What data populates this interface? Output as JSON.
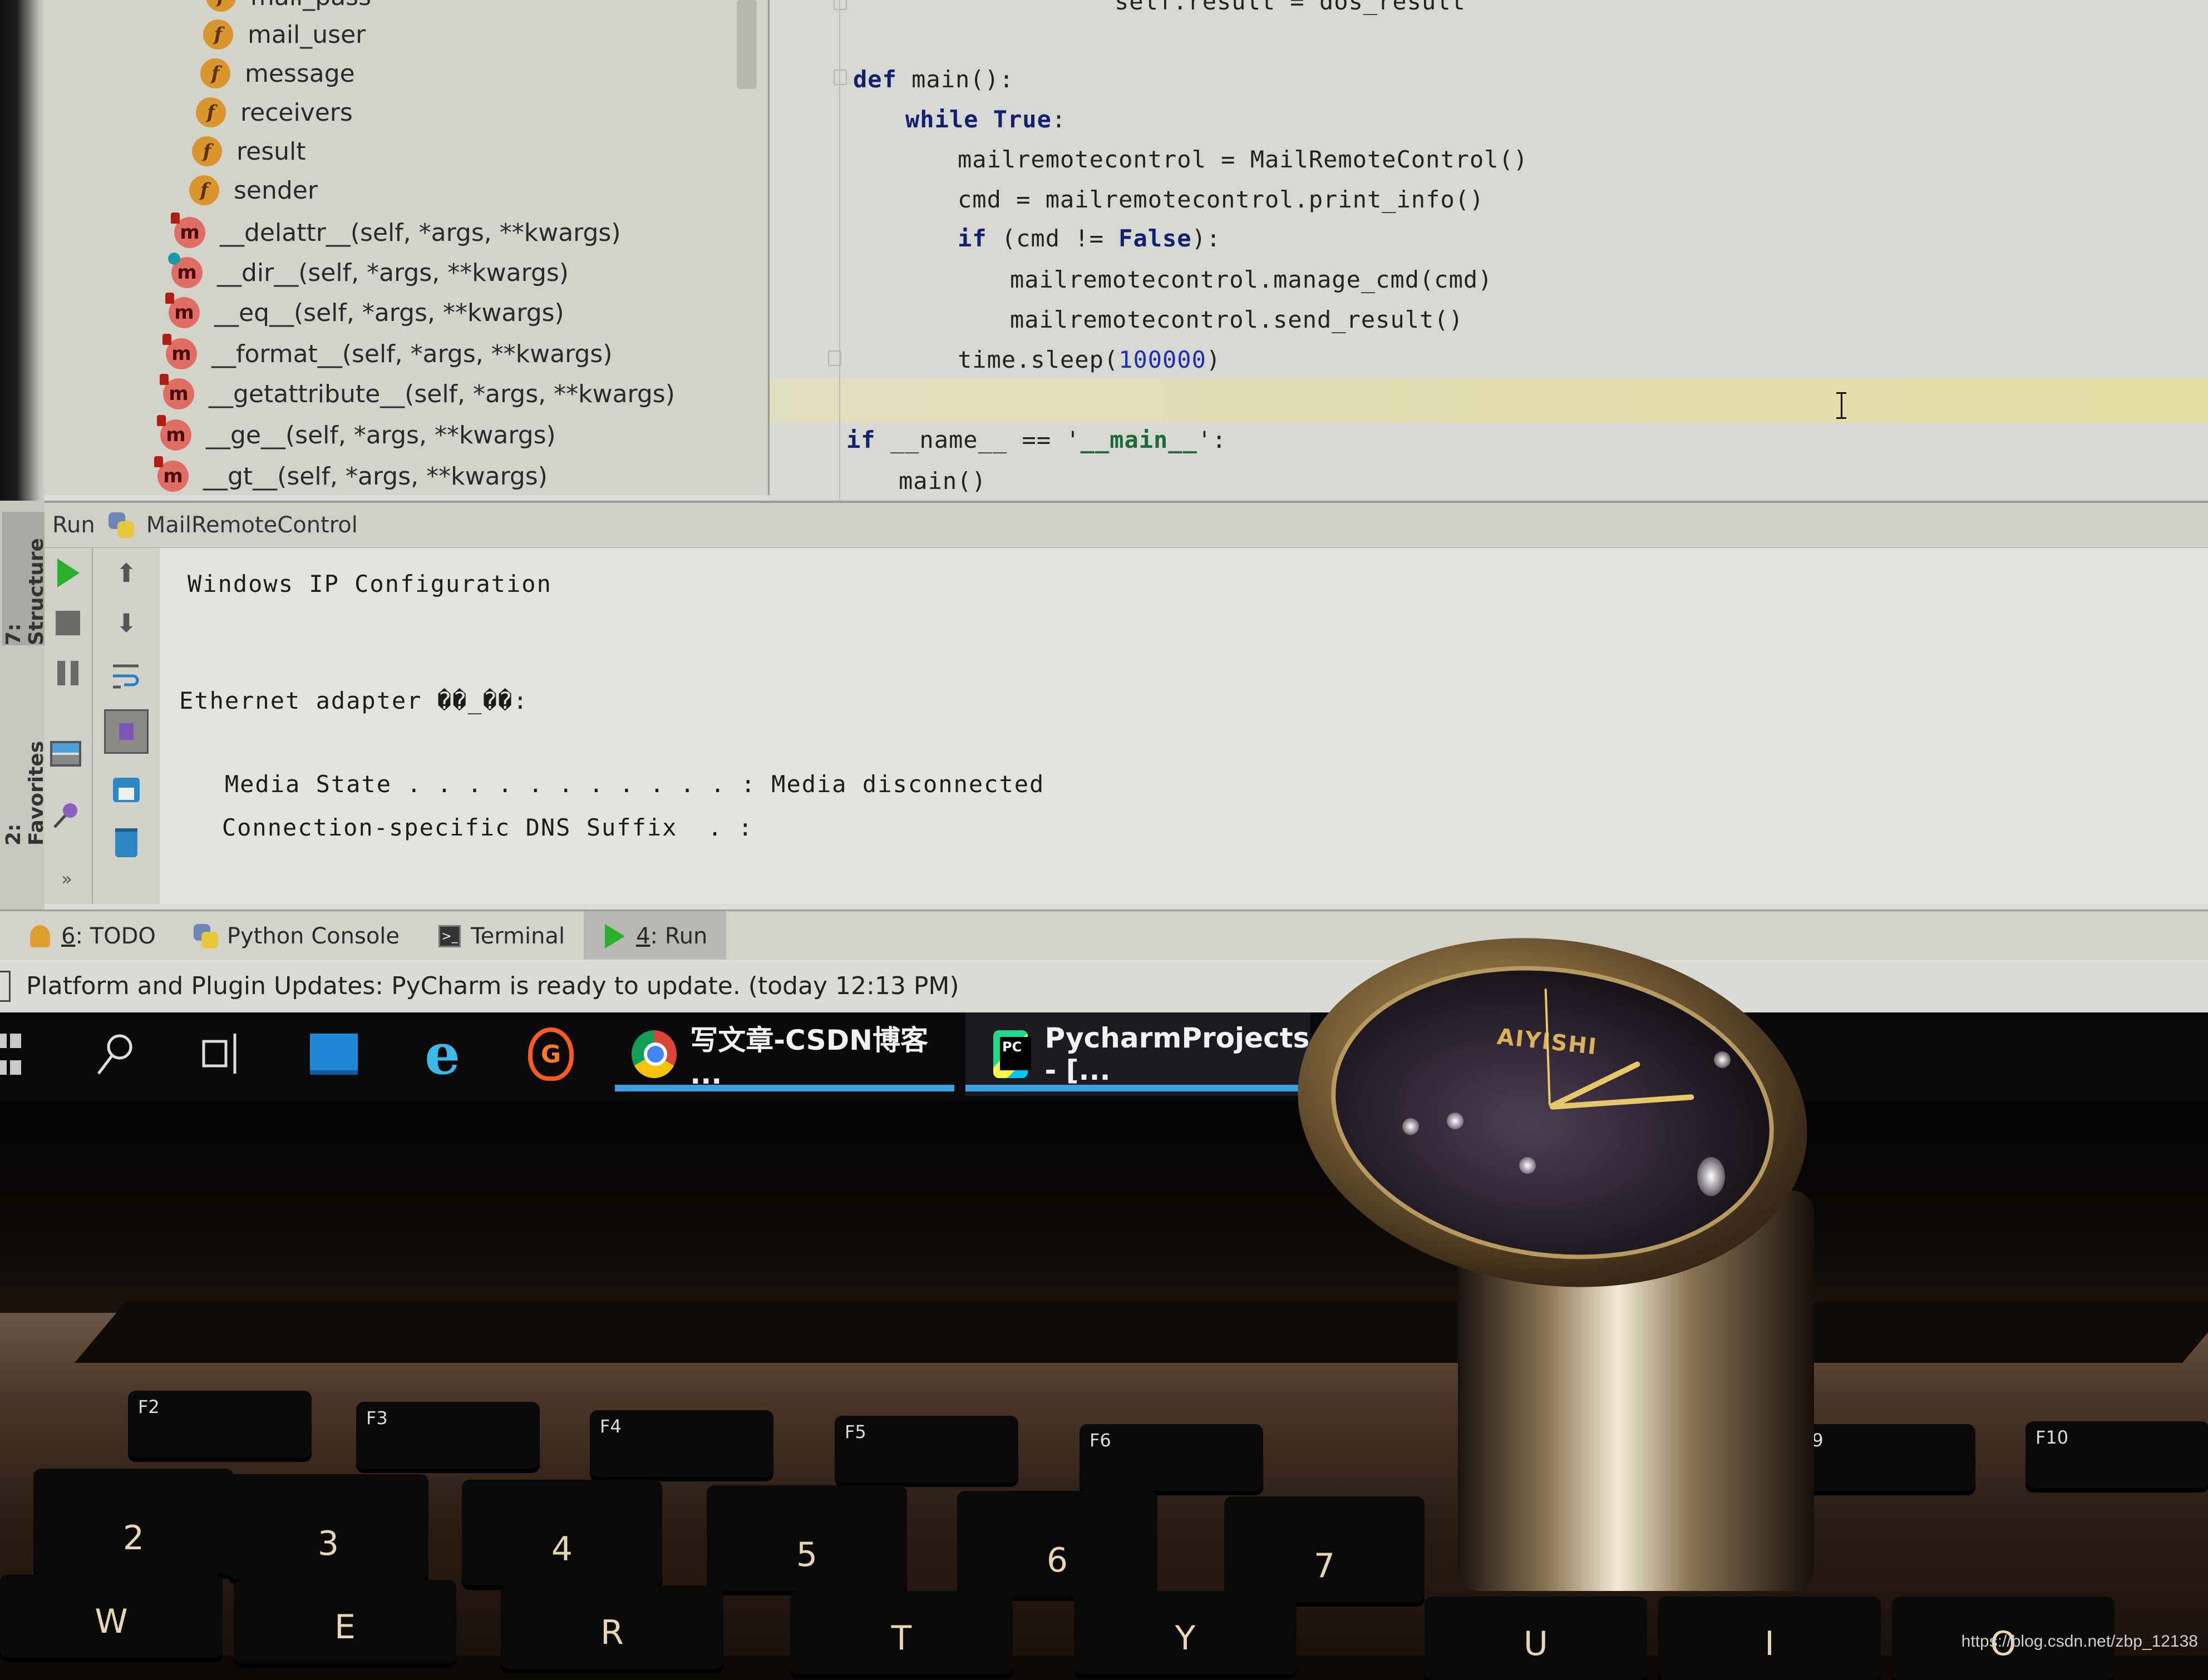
{
  "ide": {
    "structure_panel": {
      "fields": [
        {
          "icon": "field-icon",
          "icon_letter": "f",
          "label": "mail_pass"
        },
        {
          "icon": "field-icon",
          "icon_letter": "f",
          "label": "mail_user"
        },
        {
          "icon": "field-icon",
          "icon_letter": "f",
          "label": "message"
        },
        {
          "icon": "field-icon",
          "icon_letter": "f",
          "label": "receivers"
        },
        {
          "icon": "field-icon",
          "icon_letter": "f",
          "label": "result"
        },
        {
          "icon": "field-icon",
          "icon_letter": "f",
          "label": "sender"
        }
      ],
      "methods": [
        {
          "icon": "method-icon",
          "icon_letter": "m",
          "label": "__delattr__(self, *args, **kwargs)"
        },
        {
          "icon": "method-icon",
          "icon_letter": "m",
          "label": "__dir__(self, *args, **kwargs)"
        },
        {
          "icon": "method-icon",
          "icon_letter": "m",
          "label": "__eq__(self, *args, **kwargs)"
        },
        {
          "icon": "method-icon",
          "icon_letter": "m",
          "label": "__format__(self, *args, **kwargs)"
        },
        {
          "icon": "method-icon",
          "icon_letter": "m",
          "label": "__getattribute__(self, *args, **kwargs)"
        },
        {
          "icon": "method-icon",
          "icon_letter": "m",
          "label": "__ge__(self, *args, **kwargs)"
        },
        {
          "icon": "method-icon",
          "icon_letter": "m",
          "label": "__gt__(self, *args, **kwargs)"
        }
      ]
    },
    "editor": {
      "lines": [
        {
          "indent": 5,
          "parts": [
            {
              "t": "self.result = dos_result",
              "c": ""
            }
          ]
        },
        {
          "indent": 0,
          "parts": []
        },
        {
          "indent": 0,
          "parts": [
            {
              "t": "def",
              "c": "kw"
            },
            {
              "t": " main():",
              "c": ""
            }
          ]
        },
        {
          "indent": 1,
          "parts": [
            {
              "t": "while",
              "c": "kw"
            },
            {
              "t": " ",
              "c": ""
            },
            {
              "t": "True",
              "c": "kw"
            },
            {
              "t": ":",
              "c": ""
            }
          ]
        },
        {
          "indent": 2,
          "parts": [
            {
              "t": "mailremotecontrol = MailRemoteControl()",
              "c": ""
            }
          ]
        },
        {
          "indent": 2,
          "parts": [
            {
              "t": "cmd = mailremotecontrol.print_info()",
              "c": ""
            }
          ]
        },
        {
          "indent": 2,
          "parts": [
            {
              "t": "if",
              "c": "kw"
            },
            {
              "t": " (cmd != ",
              "c": ""
            },
            {
              "t": "False",
              "c": "kw"
            },
            {
              "t": "):",
              "c": ""
            }
          ]
        },
        {
          "indent": 3,
          "parts": [
            {
              "t": "mailremotecontrol.manage_cmd(cmd)",
              "c": ""
            }
          ]
        },
        {
          "indent": 3,
          "parts": [
            {
              "t": "mailremotecontrol.send_result()",
              "c": ""
            }
          ]
        },
        {
          "indent": 2,
          "parts": [
            {
              "t": "time.sleep(",
              "c": ""
            },
            {
              "t": "100000",
              "c": "num"
            },
            {
              "t": ")",
              "c": ""
            }
          ]
        },
        {
          "indent": 0,
          "parts": []
        },
        {
          "indent": 0,
          "parts": [
            {
              "t": "if",
              "c": "kw"
            },
            {
              "t": " __name__ == '",
              "c": ""
            },
            {
              "t": "__main__",
              "c": "str"
            },
            {
              "t": "':",
              "c": ""
            }
          ]
        },
        {
          "indent": 1,
          "parts": [
            {
              "t": "main()",
              "c": ""
            }
          ]
        }
      ]
    },
    "run_panel": {
      "label": "Run",
      "config_name": "MailRemoteControl",
      "toolbar_left": [
        "rerun-icon",
        "stop-icon",
        "pause-icon",
        "layout-icon",
        "pin-icon"
      ],
      "toolbar_right": [
        "up-arrow-icon",
        "down-arrow-icon",
        "soft-wrap-icon",
        "scroll-to-end-icon",
        "print-icon",
        "trash-icon"
      ],
      "console_lines": [
        "Windows IP Configuration",
        "",
        "",
        "Ethernet adapter ��_��:",
        "",
        "   Media State . . . . . . . . . . . : Media disconnected",
        "   Connection-specific DNS Suffix  . :"
      ]
    },
    "side_tabs": [
      {
        "label": "7: Structure",
        "active": true
      },
      {
        "label": "2: Favorites",
        "active": false
      }
    ],
    "more_label": "»",
    "tool_tabs": [
      {
        "num": "6",
        "label": ": TODO",
        "icon": "todo-icon",
        "active": false
      },
      {
        "num": "",
        "label": "Python Console",
        "icon": "python-console-icon",
        "active": false
      },
      {
        "num": "",
        "label": "Terminal",
        "icon": "terminal-icon",
        "active": false
      },
      {
        "num": "4",
        "label": ": Run",
        "icon": "run-icon",
        "active": true
      }
    ],
    "status_message": "Platform and Plugin Updates: PyCharm is ready to update. (today 12:13 PM)"
  },
  "taskbar": {
    "icons": [
      "windows-start-icon",
      "search-icon",
      "task-view-icon",
      "blue-app-icon",
      "internet-explorer-icon",
      "g-app-icon"
    ],
    "apps": [
      {
        "icon": "chrome-icon",
        "label": "写文章-CSDN博客 ...",
        "active": false
      },
      {
        "icon": "pycharm-icon",
        "label": "PycharmProjects - [...",
        "active": true
      }
    ]
  },
  "keyboard": {
    "fkeys": [
      "F2",
      "F3",
      "F4",
      "F5",
      "F6",
      "F9",
      "F10"
    ],
    "number_keys": [
      "2",
      "3",
      "4",
      "5",
      "6",
      "7"
    ],
    "letter_keys": [
      "W",
      "E",
      "R",
      "T",
      "Y",
      "U",
      "I",
      "O"
    ]
  },
  "watch": {
    "brand": "AIYISHI"
  },
  "watermark": "https://blog.csdn.net/zbp_12138",
  "colors": {
    "keyword": "#12206f",
    "number": "#1f2fb0",
    "field_icon": "#d9962f",
    "method_icon": "#de6d63",
    "run_green": "#2bb02b",
    "taskbar_accent": "#3ea0e0"
  }
}
